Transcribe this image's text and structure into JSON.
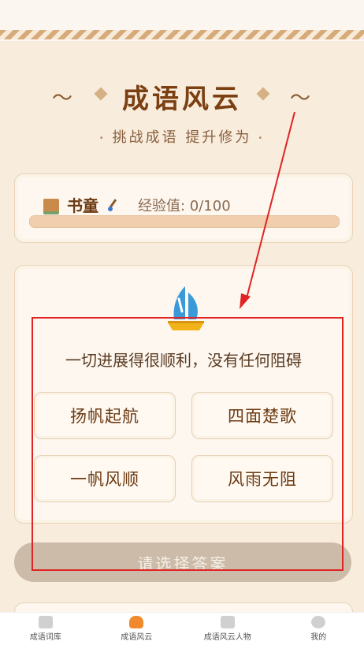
{
  "header": {
    "title": "成语风云",
    "subtitle": "挑战成语 提升修为",
    "tilde_left": "～",
    "tilde_right": "～"
  },
  "level": {
    "name": "书童",
    "exp_text": "经验值: 0/100",
    "progress_fraction": 0.0
  },
  "quiz": {
    "question": "一切进展得很顺利，没有任何阻碍",
    "options": [
      "扬帆起航",
      "四面楚歌",
      "一帆风顺",
      "风雨无阻"
    ]
  },
  "submit_label": "请选择答案",
  "tabbar": {
    "items": [
      {
        "label": "成语词库",
        "icon": "idiom-library-icon"
      },
      {
        "label": "成语风云",
        "icon": "quiz-icon"
      },
      {
        "label": "成语风云人物",
        "icon": "book-icon"
      },
      {
        "label": "我的",
        "icon": "profile-icon"
      }
    ],
    "active_index": 1
  },
  "colors": {
    "accent": "#f08a2c",
    "annotation": "#e02424",
    "title": "#7b3f12"
  }
}
